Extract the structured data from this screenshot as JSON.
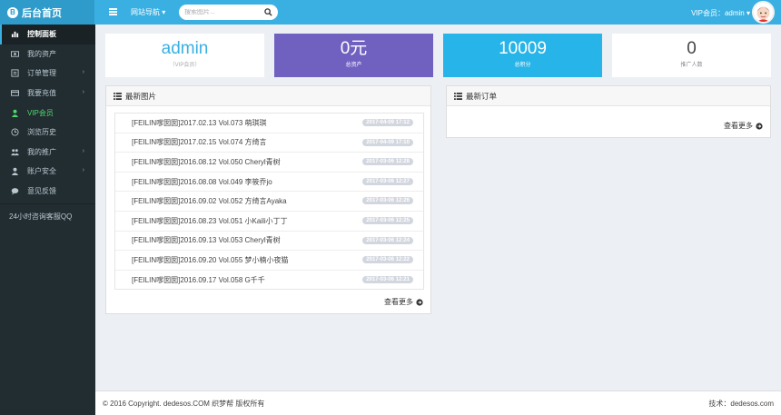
{
  "header": {
    "logo_text": "后台首页",
    "logo_badge": "B",
    "site_nav_label": "网站导航 ▾",
    "search_placeholder": "搜索图片...",
    "user_label": "VIP会员：admin ▾"
  },
  "sidebar": {
    "items": [
      {
        "label": "控制面板",
        "icon": "dashboard-icon"
      },
      {
        "label": "我的资产",
        "icon": "money-icon"
      },
      {
        "label": "订单管理",
        "icon": "list-icon"
      },
      {
        "label": "我要充值",
        "icon": "card-icon"
      },
      {
        "label": "VIP会员",
        "icon": "user-icon"
      },
      {
        "label": "浏览历史",
        "icon": "clock-icon"
      },
      {
        "label": "我的推广",
        "icon": "users-icon"
      },
      {
        "label": "账户安全",
        "icon": "user-shield-icon"
      },
      {
        "label": "意见反馈",
        "icon": "comment-icon"
      }
    ],
    "qq_label": "24小时咨询客服QQ"
  },
  "stats": [
    {
      "value": "admin",
      "label": "（VIP会员）"
    },
    {
      "value": "0元",
      "label": "总资产"
    },
    {
      "value": "10009",
      "label": "总积分"
    },
    {
      "value": "0",
      "label": "推广人数"
    }
  ],
  "images_panel": {
    "title": "最新图片",
    "more": "查看更多",
    "rows": [
      {
        "title": "[FEILIN嗲囡囡]2017.02.13 Vol.073 萌琪琪",
        "date": "2017-04-09 17:12"
      },
      {
        "title": "[FEILIN嗲囡囡]2017.02.15 Vol.074 方绮言",
        "date": "2017-04-09 17:10"
      },
      {
        "title": "[FEILIN嗲囡囡]2016.08.12 Vol.050 Cheryl青树",
        "date": "2017-03-06 12:28"
      },
      {
        "title": "[FEILIN嗲囡囡]2016.08.08 Vol.049 李筱乔jo",
        "date": "2017-03-06 12:27"
      },
      {
        "title": "[FEILIN嗲囡囡]2016.09.02 Vol.052 方绮言Ayaka",
        "date": "2017-03-06 12:26"
      },
      {
        "title": "[FEILIN嗲囡囡]2016.08.23 Vol.051 小Kaili小丁丁",
        "date": "2017-03-06 12:25"
      },
      {
        "title": "[FEILIN嗲囡囡]2016.09.13 Vol.053 Cheryl青树",
        "date": "2017-03-06 12:24"
      },
      {
        "title": "[FEILIN嗲囡囡]2016.09.20 Vol.055 梦小楠小夜猫",
        "date": "2017-03-06 12:22"
      },
      {
        "title": "[FEILIN嗲囡囡]2016.09.17 Vol.058 G千千",
        "date": "2017-03-06 12:21"
      }
    ]
  },
  "orders_panel": {
    "title": "最新订单",
    "more": "查看更多"
  },
  "footer": {
    "copyright": "© 2016 Copyright. dedesos.COM 织梦帮 版权所有",
    "tech": "技术：dedesos.com"
  },
  "colors": {
    "topbar": "#3ab0e2",
    "sidebar": "#222d32",
    "stat_purple": "#7061c0",
    "stat_blue": "#27b4e8",
    "vip_green": "#4dd96b"
  }
}
